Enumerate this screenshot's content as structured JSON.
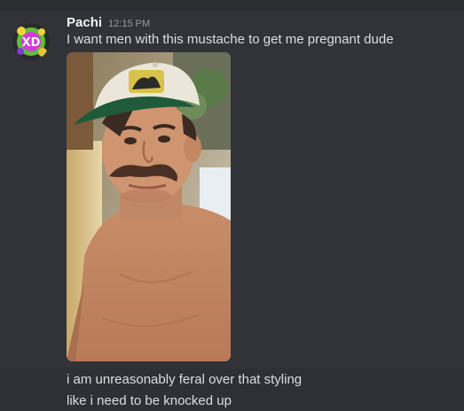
{
  "message": {
    "author": "Pachi",
    "timestamp": "12:15 PM",
    "text": "I want men with this mustache to get me pregnant dude",
    "attachment": {
      "type": "image"
    }
  },
  "followups": [
    {
      "text": "i am unreasonably feral over that styling"
    },
    {
      "text": "like i need to be knocked up"
    }
  ],
  "avatar": {
    "text": "XD"
  },
  "colors": {
    "background": "#313338",
    "text": "#dbdee1",
    "username": "#f2f3f5",
    "timestamp": "#949ba4",
    "hover_row": "#2e3035"
  }
}
